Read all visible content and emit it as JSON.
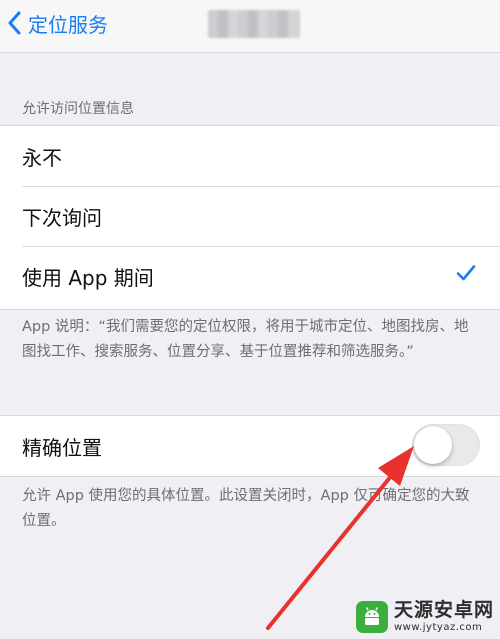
{
  "nav": {
    "back_label": "定位服务"
  },
  "section": {
    "header": "允许访问位置信息",
    "options": [
      {
        "label": "永不",
        "selected": false
      },
      {
        "label": "下次询问",
        "selected": false
      },
      {
        "label": "使用 App 期间",
        "selected": true
      }
    ],
    "footer": "App 说明：“我们需要您的定位权限，将用于城市定位、地图找房、地图找工作、搜索服务、位置分享、基于位置推荐和筛选服务。”"
  },
  "precise": {
    "label": "精确位置",
    "enabled": false,
    "footer": "允许 App 使用您的具体位置。此设置关闭时，App 仅可确定您的大致位置。"
  },
  "watermark": {
    "name": "天源安卓网",
    "url": "www.jytyaz.com"
  },
  "colors": {
    "accent": "#1a7cf5",
    "annotation_arrow": "#e8322d",
    "watermark_green": "#3cae3c"
  },
  "icons": {
    "back": "chevron-left-icon",
    "selected": "checkmark-icon",
    "annotation": "red-arrow-icon",
    "logo": "android-logo-icon"
  }
}
